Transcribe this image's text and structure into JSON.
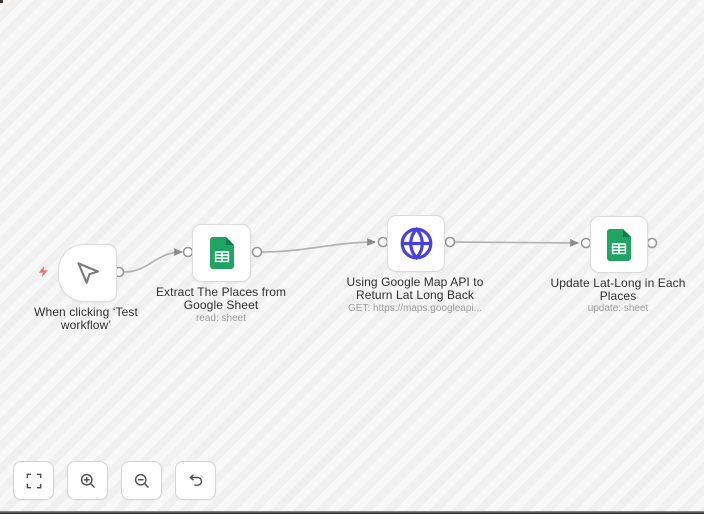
{
  "canvas": {
    "stripe_light": "#f8f8f8",
    "stripe_dark": "#f0f0f0"
  },
  "nodes": [
    {
      "id": "manual-trigger",
      "type": "trigger",
      "icon": "cursor-icon",
      "badge_icon": "lightning-bolt-icon",
      "label": "When clicking ‘Test\nworkflow’",
      "subtitle": ""
    },
    {
      "id": "google-sheets-read",
      "type": "action",
      "icon": "google-sheets-icon",
      "label": "Extract The Places from\nGoogle Sheet",
      "subtitle": "read: sheet"
    },
    {
      "id": "http-request",
      "type": "action",
      "icon": "globe-icon",
      "label": "Using Google Map API to\nReturn Lat Long Back",
      "subtitle": "GET: https://maps.googleapi..."
    },
    {
      "id": "google-sheets-update",
      "type": "action",
      "icon": "google-sheets-icon",
      "label": "Update Lat-Long in Each\nPlaces",
      "subtitle": "update: sheet"
    }
  ],
  "toolbar": {
    "buttons": [
      {
        "name": "zoom-to-fit",
        "icon": "fit-view-icon"
      },
      {
        "name": "zoom-in",
        "icon": "zoom-in-icon"
      },
      {
        "name": "zoom-out",
        "icon": "zoom-out-icon"
      },
      {
        "name": "reset-zoom",
        "icon": "undo-arrow-icon"
      }
    ]
  },
  "colors": {
    "stripe_light": "#f8f8f8",
    "stripe_dark": "#f0f0f0",
    "node_border": "#dbdbdb",
    "edge": "#b4b4b4",
    "edge_arrow": "#8c8c8c",
    "port_border": "#979797",
    "label": "#2f2f2f",
    "subtitle": "#9b9b9b",
    "sheets_green": "#1fa463",
    "sheets_green_dark": "#128049",
    "globe_blue": "#4640df",
    "trigger_bolt": "#ff6d5a",
    "cursor_gray": "#7a7a7a",
    "toolbar_icon": "#4f4f4f"
  }
}
